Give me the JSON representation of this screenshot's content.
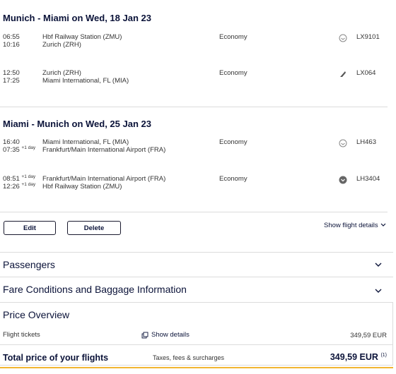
{
  "itineraries": [
    {
      "title": "Munich - Miami on Wed, 18 Jan 23",
      "segments": [
        {
          "dep_time": "06:55",
          "dep_day": "",
          "arr_time": "10:16",
          "arr_day": "",
          "from": "Hbf Railway Station (ZMU)",
          "to": "Zurich (ZRH)",
          "cabin": "Economy",
          "carrier_icon": "swiss-icon",
          "flight": "LX9101"
        },
        {
          "dep_time": "12:50",
          "dep_day": "",
          "arr_time": "17:25",
          "arr_day": "",
          "from": "Zurich (ZRH)",
          "to": "Miami International, FL (MIA)",
          "cabin": "Economy",
          "carrier_icon": "swiss-tail-icon",
          "flight": "LX064"
        }
      ]
    },
    {
      "title": "Miami - Munich on Wed, 25 Jan 23",
      "segments": [
        {
          "dep_time": "16:40",
          "dep_day": "",
          "arr_time": "07:35",
          "arr_day": "+1 day",
          "from": "Miami International, FL (MIA)",
          "to": "Frankfurt/Main International Airport (FRA)",
          "cabin": "Economy",
          "carrier_icon": "lufthansa-icon",
          "flight": "LH463"
        },
        {
          "dep_time": "08:51",
          "dep_day": "+1 day",
          "arr_time": "12:26",
          "arr_day": "+1 day",
          "from": "Frankfurt/Main International Airport (FRA)",
          "to": "Hbf Railway Station (ZMU)",
          "cabin": "Economy",
          "carrier_icon": "lufthansa-dark-icon",
          "flight": "LH3404"
        }
      ]
    }
  ],
  "actions": {
    "edit": "Edit",
    "delete": "Delete",
    "show_flight_details": "Show flight details"
  },
  "sections": {
    "passengers": "Passengers",
    "fare_conditions": "Fare Conditions and Baggage Information"
  },
  "price": {
    "title": "Price Overview",
    "flight_tickets_label": "Flight tickets",
    "show_details": "Show details",
    "flight_tickets_amount": "349,59 EUR",
    "total_label": "Total price of your flights",
    "taxes_label": "Taxes, fees & surcharges",
    "total_amount": "349,59 EUR",
    "total_footnote": "(1)"
  },
  "colors": {
    "accent": "#0b1339",
    "divider": "#dcdcdc",
    "highlight": "#f2b632"
  }
}
